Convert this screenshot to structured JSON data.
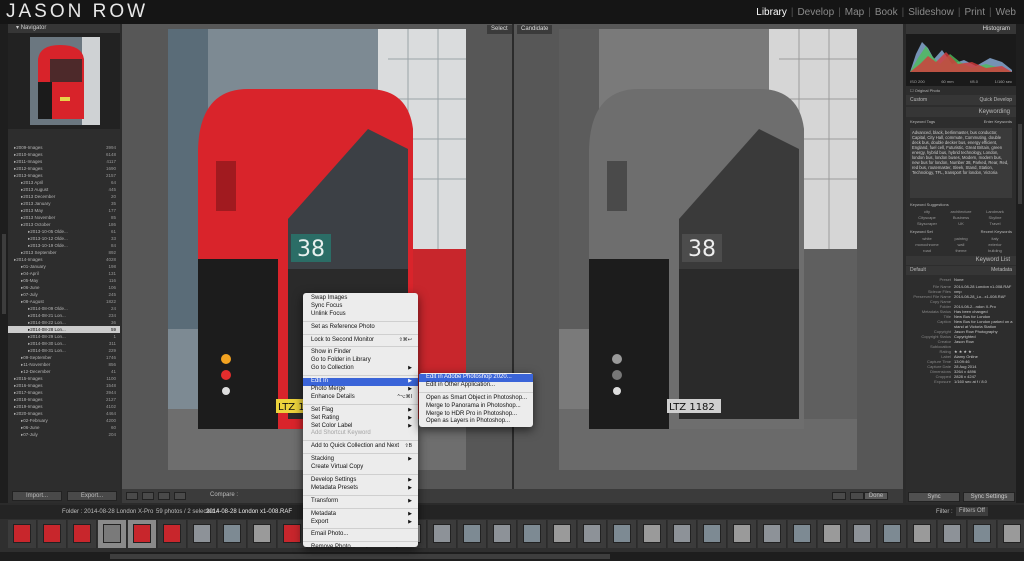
{
  "app": {
    "logo": "JASON ROW"
  },
  "modules": [
    "Library",
    "Develop",
    "Map",
    "Book",
    "Slideshow",
    "Print",
    "Web"
  ],
  "active_module": "Library",
  "navigator": {
    "label": "Navigator"
  },
  "folders": [
    {
      "label": "2009-Images",
      "count": "3994",
      "indent": 0,
      "sel": false
    },
    {
      "label": "2010-Images",
      "count": "6148",
      "indent": 0,
      "sel": false
    },
    {
      "label": "2011-Images",
      "count": "4117",
      "indent": 0,
      "sel": false
    },
    {
      "label": "2012-Images",
      "count": "1690",
      "indent": 0,
      "sel": false
    },
    {
      "label": "2013-Images",
      "count": "2157",
      "indent": 0,
      "sel": false
    },
    {
      "label": "2013 April",
      "count": "64",
      "indent": 1,
      "sel": false
    },
    {
      "label": "2013 August",
      "count": "445",
      "indent": 1,
      "sel": false
    },
    {
      "label": "2013 December",
      "count": "20",
      "indent": 1,
      "sel": false
    },
    {
      "label": "2013 January",
      "count": "35",
      "indent": 1,
      "sel": false
    },
    {
      "label": "2013 May",
      "count": "177",
      "indent": 1,
      "sel": false
    },
    {
      "label": "2013 November",
      "count": "85",
      "indent": 1,
      "sel": false
    },
    {
      "label": "2013 October",
      "count": "186",
      "indent": 1,
      "sel": false
    },
    {
      "label": "2013-10-05 Olde...",
      "count": "61",
      "indent": 2,
      "sel": false
    },
    {
      "label": "2013-10-12 Olde...",
      "count": "33",
      "indent": 2,
      "sel": false
    },
    {
      "label": "2013-10-19 Olde...",
      "count": "84",
      "indent": 2,
      "sel": false
    },
    {
      "label": "2013 September",
      "count": "892",
      "indent": 1,
      "sel": false
    },
    {
      "label": "2014-Images",
      "count": "4028",
      "indent": 0,
      "sel": false
    },
    {
      "label": "01-January",
      "count": "198",
      "indent": 1,
      "sel": false
    },
    {
      "label": "04-April",
      "count": "131",
      "indent": 1,
      "sel": false
    },
    {
      "label": "05-May",
      "count": "116",
      "indent": 1,
      "sel": false
    },
    {
      "label": "06-June",
      "count": "106",
      "indent": 1,
      "sel": false
    },
    {
      "label": "07-July",
      "count": "245",
      "indent": 1,
      "sel": false
    },
    {
      "label": "08-August",
      "count": "1822",
      "indent": 1,
      "sel": false
    },
    {
      "label": "2014-08-09 Olde...",
      "count": "24",
      "indent": 2,
      "sel": false
    },
    {
      "label": "2014-08-21 Lon...",
      "count": "234",
      "indent": 2,
      "sel": false
    },
    {
      "label": "2014-08-22 Lon...",
      "count": "36",
      "indent": 2,
      "sel": false
    },
    {
      "label": "2014-08-28 Lon...",
      "count": "59",
      "indent": 2,
      "sel": true
    },
    {
      "label": "2014-08-29 Lon...",
      "count": "1",
      "indent": 2,
      "sel": false
    },
    {
      "label": "2014-08-30 Lon...",
      "count": "311",
      "indent": 2,
      "sel": false
    },
    {
      "label": "2014-08-31 Lon...",
      "count": "229",
      "indent": 2,
      "sel": false
    },
    {
      "label": "09-September",
      "count": "1746",
      "indent": 1,
      "sel": false
    },
    {
      "label": "11-November",
      "count": "856",
      "indent": 1,
      "sel": false
    },
    {
      "label": "12-December",
      "count": "41",
      "indent": 1,
      "sel": false
    },
    {
      "label": "2015-Images",
      "count": "1100",
      "indent": 0,
      "sel": false
    },
    {
      "label": "2016-Images",
      "count": "1548",
      "indent": 0,
      "sel": false
    },
    {
      "label": "2017-Images",
      "count": "3944",
      "indent": 0,
      "sel": false
    },
    {
      "label": "2018-Images",
      "count": "2127",
      "indent": 0,
      "sel": false
    },
    {
      "label": "2019-Images",
      "count": "4102",
      "indent": 0,
      "sel": false
    },
    {
      "label": "2020-Images",
      "count": "4464",
      "indent": 0,
      "sel": false
    },
    {
      "label": "02-February",
      "count": "4200",
      "indent": 1,
      "sel": false
    },
    {
      "label": "06-June",
      "count": "60",
      "indent": 1,
      "sel": false
    },
    {
      "label": "07-July",
      "count": "204",
      "indent": 1,
      "sel": false
    }
  ],
  "left_buttons": {
    "import": "Import...",
    "export": "Export..."
  },
  "center": {
    "select_tag": "Select",
    "candidate_tag": "Candidate",
    "plate_left": "LTZ 1182",
    "plate_right": "LTZ 1182",
    "route": "38"
  },
  "toolbar": {
    "compare_label": "Compare :",
    "done": "Done"
  },
  "right_panel": {
    "histogram": "Histogram",
    "hist_info": [
      "ISO 200",
      "60 mm",
      "f/8.0",
      "1/160 sec"
    ],
    "original_photo": "Original Photo",
    "custom": "Custom",
    "quick_develop": "Quick Develop",
    "keywording": "Keywording",
    "keyword_tags": "Keyword Tags",
    "enter_keywords": "Enter Keywords",
    "keywords_text": "Advanced, black, berlinmaster, bus conductor, Capital, City Hall, commute, Commuting, double deck bus, double decker bus, energy efficient, England, fuel cell, Futuristic, Great Britain, green energy, hybrid bus, hybrid technology, London, london bus, london buses, Modern, modern bus, new bus for london, Number 38, Parked, Rear, Red, red bus, routemaster, Sleek, Stand, Station, Technology, TFL, transport for london, Victoria",
    "keyword_suggestions": "Keyword Suggestions",
    "suggestions": [
      "city",
      "architecture",
      "Landmark",
      "Cityscape",
      "Business",
      "Skyline",
      "Skyscraper",
      "UK",
      "Travel"
    ],
    "keyword_set": "Keyword Set",
    "recent_keywords": "Recent Keywords",
    "recent": [
      "white",
      "paintng",
      "italy",
      "monochrome",
      "wall",
      "exterior",
      "road",
      "theme",
      "building"
    ],
    "keyword_list": "Keyword List",
    "default": "Default",
    "metadata": "Metadata",
    "preset": "Preset",
    "none": "None",
    "meta": [
      {
        "label": "File Name",
        "value": "2014-08-28 London x1-008.RAF"
      },
      {
        "label": "Sidecar Files",
        "value": "xmp"
      },
      {
        "label": "Preserved File Name",
        "value": "2014-08-28_Lo...x1-008.RAF"
      },
      {
        "label": "Copy Name",
        "value": ""
      },
      {
        "label": "Folder",
        "value": "2014-08-2...ndon X-Pro"
      },
      {
        "label": "Metadata Status",
        "value": "Has been changed"
      },
      {
        "label": "Title",
        "value": "New Bus for London"
      },
      {
        "label": "Caption",
        "value": "New Bus for London parked on a stand at Victoria Station"
      },
      {
        "label": "Copyright",
        "value": "Jason Row Photography"
      },
      {
        "label": "Copyright Status",
        "value": "Copyrighted"
      },
      {
        "label": "Creator",
        "value": "Jason Row"
      },
      {
        "label": "Sublocation",
        "value": ""
      },
      {
        "label": "Rating",
        "value": "★ ★ ★ ★ ·"
      },
      {
        "label": "Label",
        "value": "Alamy Online"
      },
      {
        "label": "Capture Time",
        "value": "13:09:46"
      },
      {
        "label": "Capture Date",
        "value": "28 Aug 2014"
      },
      {
        "label": "Dimensions",
        "value": "3264 x 4896"
      },
      {
        "label": "Cropped",
        "value": "2828 x 4247"
      },
      {
        "label": "Exposure",
        "value": "1/160 sec at f / 8.0"
      }
    ],
    "sync": "Sync",
    "sync_settings": "Sync Settings"
  },
  "filmstrip": {
    "folder": "Folder : 2014-08-28 London X-Pro",
    "count": "59 photos / 2 selected /",
    "file": "2014-08-28 London x1-008.RAF",
    "filter_label": "Filter :",
    "filter_value": "Filters Off"
  },
  "context_menu": [
    {
      "label": "Swap Images",
      "type": "item"
    },
    {
      "label": "Sync Focus",
      "type": "item"
    },
    {
      "label": "Unlink Focus",
      "type": "item"
    },
    {
      "type": "sep"
    },
    {
      "label": "Set as Reference Photo",
      "type": "item"
    },
    {
      "type": "sep"
    },
    {
      "label": "Lock to Second Monitor",
      "type": "item",
      "shortcut": "⇧⌘↩"
    },
    {
      "type": "sep"
    },
    {
      "label": "Show in Finder",
      "type": "item"
    },
    {
      "label": "Go to Folder in Library",
      "type": "item"
    },
    {
      "label": "Go to Collection",
      "type": "item",
      "arrow": "▶"
    },
    {
      "type": "sep"
    },
    {
      "label": "Edit In",
      "type": "item",
      "arrow": "▶",
      "hl": true
    },
    {
      "label": "Photo Merge",
      "type": "item",
      "arrow": "▶"
    },
    {
      "label": "Enhance Details",
      "type": "item",
      "shortcut": "^⌥⌘I"
    },
    {
      "type": "sep"
    },
    {
      "label": "Set Flag",
      "type": "item",
      "arrow": "▶"
    },
    {
      "label": "Set Rating",
      "type": "item",
      "arrow": "▶"
    },
    {
      "label": "Set Color Label",
      "type": "item",
      "arrow": "▶"
    },
    {
      "label": "Add Shortcut Keyword",
      "type": "item",
      "dis": true
    },
    {
      "type": "sep"
    },
    {
      "label": "Add to Quick Collection and Next",
      "type": "item",
      "shortcut": "⇧B"
    },
    {
      "type": "sep"
    },
    {
      "label": "Stacking",
      "type": "item",
      "arrow": "▶"
    },
    {
      "label": "Create Virtual Copy",
      "type": "item"
    },
    {
      "type": "sep"
    },
    {
      "label": "Develop Settings",
      "type": "item",
      "arrow": "▶"
    },
    {
      "label": "Metadata Presets",
      "type": "item",
      "arrow": "▶"
    },
    {
      "type": "sep"
    },
    {
      "label": "Transform",
      "type": "item",
      "arrow": "▶"
    },
    {
      "type": "sep"
    },
    {
      "label": "Metadata",
      "type": "item",
      "arrow": "▶"
    },
    {
      "label": "Export",
      "type": "item",
      "arrow": "▶"
    },
    {
      "type": "sep"
    },
    {
      "label": "Email Photo...",
      "type": "item"
    },
    {
      "type": "sep"
    },
    {
      "label": "Remove Photo...",
      "type": "item"
    }
  ],
  "submenu": [
    {
      "label": "Edit in Adobe Photoshop 2020...",
      "type": "item",
      "hl": true
    },
    {
      "label": "Edit in Other Application...",
      "type": "item"
    },
    {
      "type": "sep"
    },
    {
      "label": "Open as Smart Object in Photoshop...",
      "type": "item"
    },
    {
      "label": "Merge to Panorama in Photoshop...",
      "type": "item"
    },
    {
      "label": "Merge to HDR Pro in Photoshop...",
      "type": "item"
    },
    {
      "label": "Open as Layers in Photoshop...",
      "type": "item"
    }
  ]
}
